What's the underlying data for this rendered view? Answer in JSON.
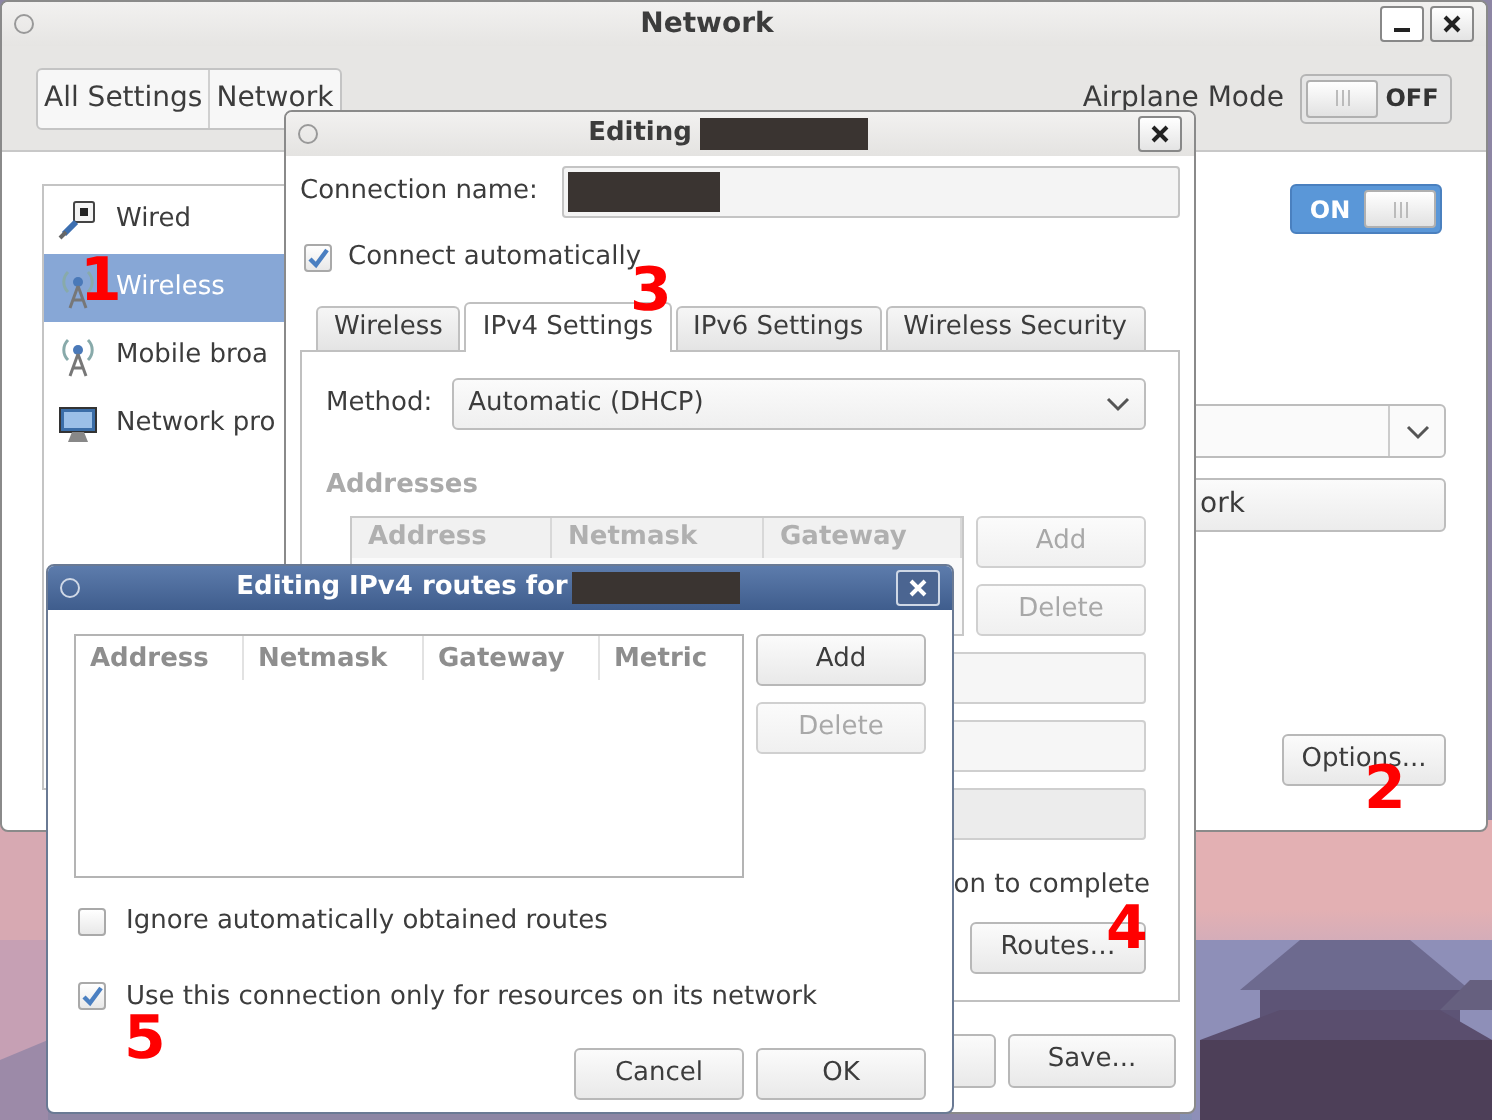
{
  "network_window": {
    "title": "Network",
    "nav_buttons": [
      "All Settings",
      "Network"
    ],
    "airplane_mode": {
      "label": "Airplane Mode",
      "on": false,
      "state_text": "OFF"
    },
    "devices": [
      {
        "name": "Wired",
        "kind": "wired",
        "selected": false
      },
      {
        "name": "Wireless",
        "kind": "wireless",
        "selected": true
      },
      {
        "name": "Mobile broa",
        "kind": "wireless",
        "selected": false
      },
      {
        "name": "Network pro",
        "kind": "proxy",
        "selected": false
      }
    ],
    "wireless_switch": {
      "on": true,
      "state_text": "ON"
    },
    "partial_button": "ork",
    "options_button": "Options..."
  },
  "editing_dialog": {
    "title": "Editing",
    "connection_name_label": "Connection name:",
    "connect_automatically": {
      "label": "Connect automatically",
      "checked": true
    },
    "tabs": [
      {
        "label": "Wireless",
        "selected": false
      },
      {
        "label": "IPv4 Settings",
        "selected": true
      },
      {
        "label": "IPv6 Settings",
        "selected": false
      },
      {
        "label": "Wireless Security",
        "selected": false
      }
    ],
    "method_label": "Method:",
    "method_value": "Automatic (DHCP)",
    "addresses_label": "Addresses",
    "address_columns": [
      "Address",
      "Netmask",
      "Gateway"
    ],
    "add_button": {
      "label": "Add",
      "disabled": true
    },
    "delete_button": {
      "label": "Delete",
      "disabled": true
    },
    "partial_text": "on to complete",
    "routes_button": "Routes…",
    "save_button": "Save..."
  },
  "routes_dialog": {
    "title": "Editing IPv4 routes for",
    "columns": [
      "Address",
      "Netmask",
      "Gateway",
      "Metric"
    ],
    "add_button": {
      "label": "Add",
      "disabled": false
    },
    "delete_button": {
      "label": "Delete",
      "disabled": true
    },
    "options": [
      {
        "label": "Ignore automatically obtained routes",
        "checked": false
      },
      {
        "label": "Use this connection only for resources on its network",
        "checked": true
      }
    ],
    "cancel_button": "Cancel",
    "ok_button": "OK"
  },
  "annotations": [
    {
      "text": "1"
    },
    {
      "text": "2"
    },
    {
      "text": "3"
    },
    {
      "text": "4"
    },
    {
      "text": "5"
    }
  ]
}
